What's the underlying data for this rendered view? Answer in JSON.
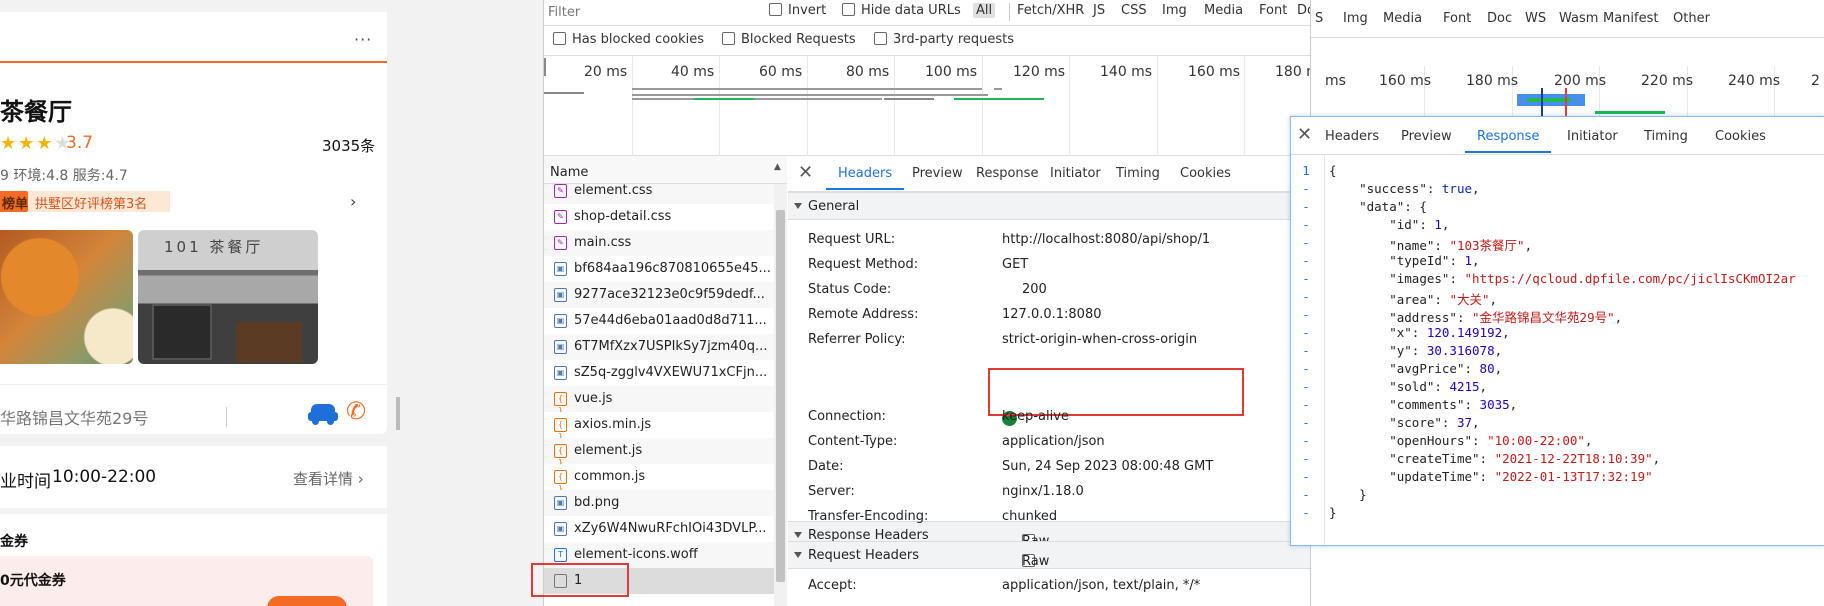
{
  "app": {
    "more_label": "···",
    "shop_name": "茶餐厅",
    "rating_value": "3.7",
    "review_count": "3035条",
    "sub_scores": "9 环境:4.8 服务:4.7",
    "rank_tag_left": "榜单",
    "rank_tag": "拱墅区好评榜第3名",
    "photo2_sign": "101 茶餐厅",
    "address": "华路锦昌文华苑29号",
    "hours_label": "业时间",
    "hours_value": "10:00-22:00",
    "details_link": "查看详情",
    "voucher_section": "金券",
    "voucher_item": "0元代金券",
    "stars_filled": 2.5,
    "colors": {
      "accent": "#f36b24",
      "phone": "#f36b24",
      "car": "#1e6fd8"
    }
  },
  "devtools": {
    "filter_placeholder": "Filter",
    "invert_label": "Invert",
    "hide_data_urls_label": "Hide data URLs",
    "type_filters": [
      "All",
      "Fetch/XHR",
      "JS",
      "CSS",
      "Img",
      "Media",
      "Font",
      "Doc"
    ],
    "type_filters_right": [
      "S",
      "Img",
      "Media",
      "Font",
      "Doc",
      "WS",
      "Wasm",
      "Manifest",
      "Other"
    ],
    "has_blocked_cookies": "Has blocked cookies",
    "blocked_requests": "Blocked Requests",
    "third_party": "3rd-party requests",
    "timeline_ticks": [
      "20 ms",
      "40 ms",
      "60 ms",
      "80 ms",
      "100 ms",
      "120 ms",
      "140 ms",
      "160 ms",
      "180 m"
    ],
    "timeline_ticks_right": [
      "ms",
      "160 ms",
      "180 ms",
      "200 ms",
      "220 ms",
      "240 ms",
      "2"
    ],
    "name_header": "Name",
    "requests": [
      {
        "name": "element.css",
        "icon": "css-icon"
      },
      {
        "name": "shop-detail.css",
        "icon": "css-icon"
      },
      {
        "name": "main.css",
        "icon": "css-icon"
      },
      {
        "name": "bf684aa196c870810655e45...",
        "icon": "image-icon"
      },
      {
        "name": "9277ace32123e0c9f59dedf...",
        "icon": "image-icon"
      },
      {
        "name": "57e44d6eba01aad0d8d711...",
        "icon": "image-icon"
      },
      {
        "name": "6T7MfXzx7USPIkSy7jzm40q...",
        "icon": "image-icon"
      },
      {
        "name": "sZ5q-zgglv4VXEWU71xCFjn...",
        "icon": "image-icon"
      },
      {
        "name": "vue.js",
        "icon": "js-icon"
      },
      {
        "name": "axios.min.js",
        "icon": "js-icon"
      },
      {
        "name": "element.js",
        "icon": "js-icon"
      },
      {
        "name": "common.js",
        "icon": "js-icon"
      },
      {
        "name": "bd.png",
        "icon": "image-icon"
      },
      {
        "name": "xZy6W4NwuRFchIOi43DVLP...",
        "icon": "image-icon"
      },
      {
        "name": "element-icons.woff",
        "icon": "font-icon"
      },
      {
        "name": "1",
        "icon": "doc-icon"
      }
    ],
    "detail_tabs": [
      "Headers",
      "Preview",
      "Response",
      "Initiator",
      "Timing",
      "Cookies"
    ],
    "general_title": "General",
    "general": [
      {
        "key": "Request URL:",
        "value": "http://localhost:8080/api/shop/1"
      },
      {
        "key": "Request Method:",
        "value": "GET"
      },
      {
        "key": "Status Code:",
        "value": "200"
      },
      {
        "key": "Remote Address:",
        "value": "127.0.0.1:8080"
      },
      {
        "key": "Referrer Policy:",
        "value": "strict-origin-when-cross-origin"
      }
    ],
    "response_headers_title": "Response Headers",
    "raw_label": "Raw",
    "response_headers": [
      {
        "key": "Connection:",
        "value": "keep-alive"
      },
      {
        "key": "Content-Type:",
        "value": "application/json"
      },
      {
        "key": "Date:",
        "value": "Sun, 24 Sep 2023 08:00:48 GMT"
      },
      {
        "key": "Server:",
        "value": "nginx/1.18.0"
      },
      {
        "key": "Transfer-Encoding:",
        "value": "chunked"
      }
    ],
    "request_headers_title": "Request Headers",
    "request_headers": [
      {
        "key": "Accept:",
        "value": "application/json, text/plain, */*"
      }
    ],
    "response_tabs": [
      "Headers",
      "Preview",
      "Response",
      "Initiator",
      "Timing",
      "Cookies"
    ],
    "response_json": [
      {
        "g": "1",
        "t": "{"
      },
      {
        "g": "-",
        "t": "    \"success\": true,"
      },
      {
        "g": "-",
        "t": "    \"data\": {"
      },
      {
        "g": "-",
        "t": "        \"id\": 1,"
      },
      {
        "g": "-",
        "t": "        \"name\": \"103茶餐厅\","
      },
      {
        "g": "-",
        "t": "        \"typeId\": 1,"
      },
      {
        "g": "-",
        "t": "        \"images\": \"https://qcloud.dpfile.com/pc/jiclIsCKmOI2ar"
      },
      {
        "g": "-",
        "t": "        \"area\": \"大关\","
      },
      {
        "g": "-",
        "t": "        \"address\": \"金华路锦昌文华苑29号\","
      },
      {
        "g": "-",
        "t": "        \"x\": 120.149192,"
      },
      {
        "g": "-",
        "t": "        \"y\": 30.316078,"
      },
      {
        "g": "-",
        "t": "        \"avgPrice\": 80,"
      },
      {
        "g": "-",
        "t": "        \"sold\": 4215,"
      },
      {
        "g": "-",
        "t": "        \"comments\": 3035,"
      },
      {
        "g": "-",
        "t": "        \"score\": 37,"
      },
      {
        "g": "-",
        "t": "        \"openHours\": \"10:00-22:00\","
      },
      {
        "g": "-",
        "t": "        \"createTime\": \"2021-12-22T18:10:39\","
      },
      {
        "g": "-",
        "t": "        \"updateTime\": \"2022-01-13T17:32:19\""
      },
      {
        "g": "-",
        "t": "    }"
      },
      {
        "g": "-",
        "t": "}"
      }
    ],
    "colors": {
      "accent": "#1a73e8",
      "highlight": "#e53935",
      "status_ok": "#188038"
    }
  }
}
